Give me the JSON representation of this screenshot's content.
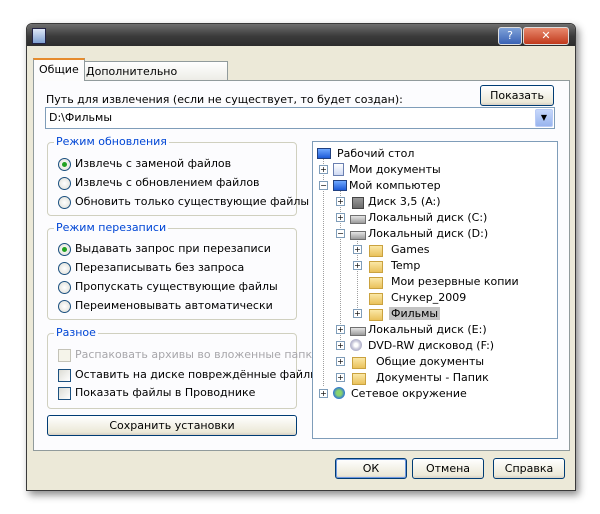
{
  "window": {
    "title": "",
    "help_button": "?",
    "close_button": "✕"
  },
  "tabs": [
    {
      "label": "Общие",
      "active": true
    },
    {
      "label": "Дополнительно",
      "active": false
    }
  ],
  "path": {
    "label": "Путь для извлечения (если не существует, то будет создан):",
    "show_button": "Показать",
    "value": "D:\\Фильмы"
  },
  "update_mode": {
    "title": "Режим обновления",
    "options": [
      {
        "label": "Извлечь с заменой файлов",
        "selected": true
      },
      {
        "label": "Извлечь с обновлением файлов",
        "selected": false
      },
      {
        "label": "Обновить только существующие файлы",
        "selected": false
      }
    ]
  },
  "overwrite_mode": {
    "title": "Режим перезаписи",
    "options": [
      {
        "label": "Выдавать запрос при перезаписи",
        "selected": true
      },
      {
        "label": "Перезаписывать без запроса",
        "selected": false
      },
      {
        "label": "Пропускать существующие файлы",
        "selected": false
      },
      {
        "label": "Переименовывать автоматически",
        "selected": false
      }
    ]
  },
  "misc": {
    "title": "Разное",
    "options": [
      {
        "label": "Распаковать архивы во вложенные папки",
        "checked": false,
        "disabled": true
      },
      {
        "label": "Оставить на диске повреждённые файлы",
        "checked": false,
        "disabled": false
      },
      {
        "label": "Показать файлы в Проводнике",
        "checked": false,
        "disabled": false
      }
    ]
  },
  "save_button": "Сохранить установки",
  "tree": {
    "items": [
      {
        "label": "Рабочий стол",
        "icon": "desktop-icon"
      },
      {
        "label": "Мои документы",
        "icon": "documents-icon",
        "expander": "+"
      },
      {
        "label": "Мой компьютер",
        "icon": "computer-icon",
        "expander": "−"
      },
      {
        "label": "Диск 3,5 (A:)",
        "icon": "floppy-icon",
        "expander": "+"
      },
      {
        "label": "Локальный диск (C:)",
        "icon": "drive-icon",
        "expander": "+"
      },
      {
        "label": "Локальный диск (D:)",
        "icon": "drive-icon",
        "expander": "−"
      },
      {
        "label": "Games",
        "icon": "folder-icon",
        "expander": "+"
      },
      {
        "label": "Temp",
        "icon": "folder-icon",
        "expander": "+"
      },
      {
        "label": "Мои резервные копии",
        "icon": "folder-icon"
      },
      {
        "label": "Снукер_2009",
        "icon": "folder-icon"
      },
      {
        "label": "Фильмы",
        "icon": "folder-icon",
        "expander": "+",
        "selected": true
      },
      {
        "label": "Локальный диск (E:)",
        "icon": "drive-icon",
        "expander": "+"
      },
      {
        "label": "DVD-RW дисковод (F:)",
        "icon": "dvd-icon",
        "expander": "+"
      },
      {
        "label": "Общие документы",
        "icon": "folder-icon",
        "expander": "+"
      },
      {
        "label": "Документы - Папик",
        "icon": "folder-icon",
        "expander": "+"
      },
      {
        "label": "Сетевое окружение",
        "icon": "network-icon",
        "expander": "+"
      }
    ]
  },
  "buttons": {
    "ok": "ОК",
    "cancel": "Отмена",
    "help": "Справка"
  }
}
